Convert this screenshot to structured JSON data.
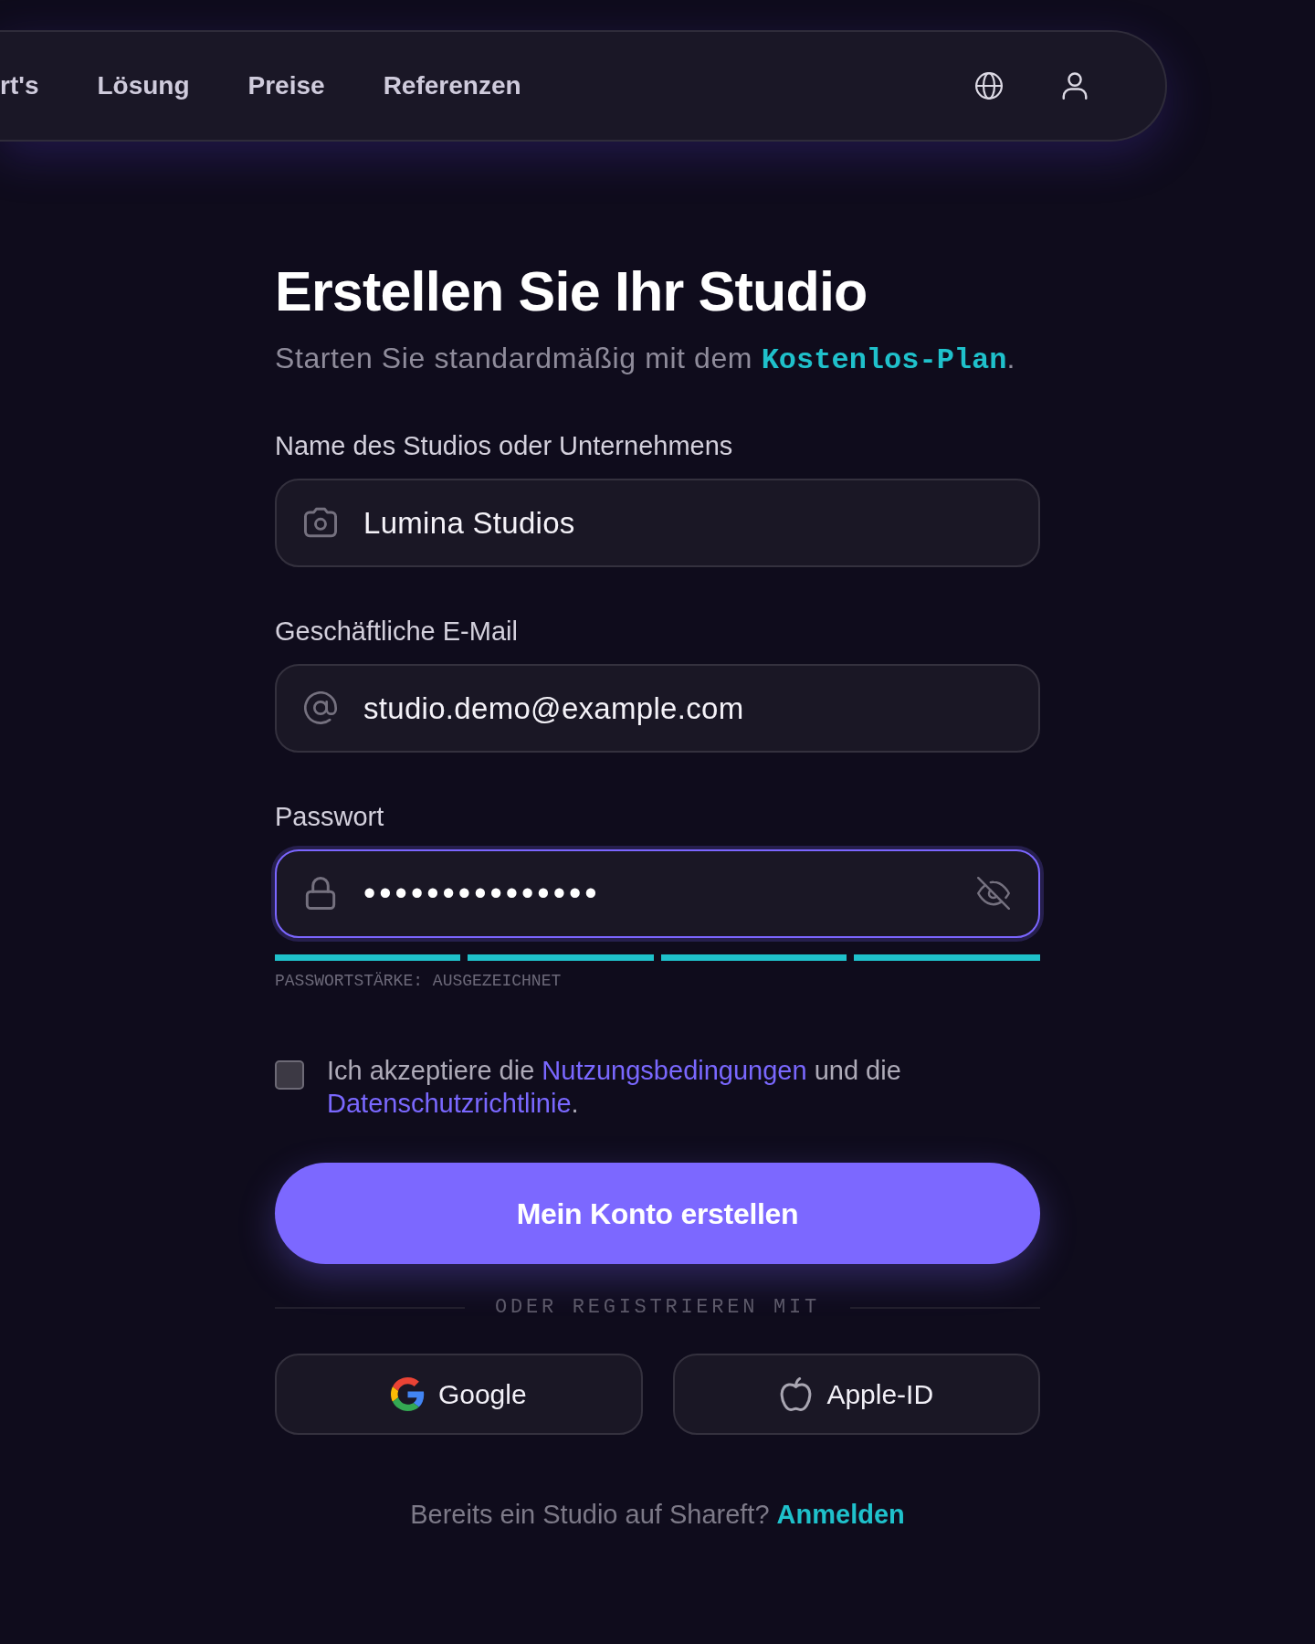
{
  "nav": {
    "items": [
      {
        "label": "rt's"
      },
      {
        "label": "Lösung"
      },
      {
        "label": "Preise"
      },
      {
        "label": "Referenzen"
      }
    ]
  },
  "title": "Erstellen Sie Ihr Studio",
  "subtitle": "Starten Sie standardmäßig mit dem **Kostenlos-Plan**.",
  "fields": [
    {
      "kind": "name",
      "label": "Name des Studios oder Unternehmens",
      "value": "Lumina Studios",
      "focused": false
    },
    {
      "kind": "email",
      "label": "Geschäftliche E-Mail",
      "value": "studio.demo@example.com",
      "focused": false
    },
    {
      "kind": "password",
      "label": "Passwort",
      "value": "•••••••••••••••",
      "focused": true,
      "strength": {
        "level": 1,
        "label": "PASSWORTSTÄRKE: AUSGEZEICHNET"
      }
    }
  ],
  "terms": {
    "checked": false,
    "parts": [
      {
        "kind": "text",
        "text": "Ich akzeptiere die "
      },
      {
        "kind": "link",
        "text": "Nutzungsbedingungen"
      },
      {
        "kind": "text",
        "text": " und die "
      },
      {
        "kind": "link",
        "text": "Datenschutzrichtlinie"
      },
      {
        "kind": "text",
        "text": "."
      }
    ]
  },
  "submit": {
    "label": "Mein Konto erstellen"
  },
  "divider": "ODER REGISTRIEREN MIT",
  "social": [
    {
      "kind": "google",
      "label": "Google"
    },
    {
      "kind": "apple",
      "label": "Apple-ID"
    }
  ],
  "footer": {
    "text": "Bereits ein Studio auf Shareft?",
    "link": "Anmelden"
  }
}
